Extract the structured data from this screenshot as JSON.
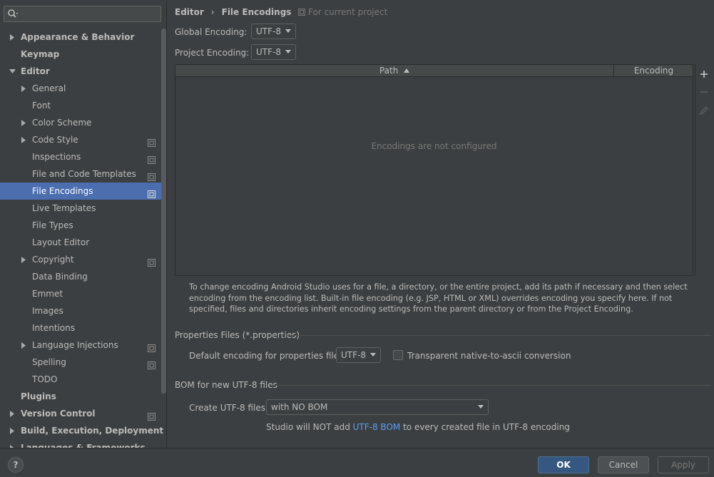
{
  "search": {
    "placeholder": ""
  },
  "sidebar": {
    "items": [
      {
        "label": "Appearance & Behavior",
        "bold": true,
        "level": 0,
        "arrow": "right",
        "proj": false
      },
      {
        "label": "Keymap",
        "bold": true,
        "level": 0,
        "arrow": "none",
        "proj": false
      },
      {
        "label": "Editor",
        "bold": true,
        "level": 0,
        "arrow": "down",
        "proj": false
      },
      {
        "label": "General",
        "bold": false,
        "level": 1,
        "arrow": "right",
        "proj": false
      },
      {
        "label": "Font",
        "bold": false,
        "level": 1,
        "arrow": "none",
        "proj": false
      },
      {
        "label": "Color Scheme",
        "bold": false,
        "level": 1,
        "arrow": "right",
        "proj": false
      },
      {
        "label": "Code Style",
        "bold": false,
        "level": 1,
        "arrow": "right",
        "proj": true
      },
      {
        "label": "Inspections",
        "bold": false,
        "level": 1,
        "arrow": "none",
        "proj": true
      },
      {
        "label": "File and Code Templates",
        "bold": false,
        "level": 1,
        "arrow": "none",
        "proj": true
      },
      {
        "label": "File Encodings",
        "bold": false,
        "level": 1,
        "arrow": "none",
        "proj": true,
        "selected": true
      },
      {
        "label": "Live Templates",
        "bold": false,
        "level": 1,
        "arrow": "none",
        "proj": false
      },
      {
        "label": "File Types",
        "bold": false,
        "level": 1,
        "arrow": "none",
        "proj": false
      },
      {
        "label": "Layout Editor",
        "bold": false,
        "level": 1,
        "arrow": "none",
        "proj": false
      },
      {
        "label": "Copyright",
        "bold": false,
        "level": 1,
        "arrow": "right",
        "proj": true
      },
      {
        "label": "Data Binding",
        "bold": false,
        "level": 1,
        "arrow": "none",
        "proj": false
      },
      {
        "label": "Emmet",
        "bold": false,
        "level": 1,
        "arrow": "none",
        "proj": false
      },
      {
        "label": "Images",
        "bold": false,
        "level": 1,
        "arrow": "none",
        "proj": false
      },
      {
        "label": "Intentions",
        "bold": false,
        "level": 1,
        "arrow": "none",
        "proj": false
      },
      {
        "label": "Language Injections",
        "bold": false,
        "level": 1,
        "arrow": "right",
        "proj": true
      },
      {
        "label": "Spelling",
        "bold": false,
        "level": 1,
        "arrow": "none",
        "proj": true
      },
      {
        "label": "TODO",
        "bold": false,
        "level": 1,
        "arrow": "none",
        "proj": false
      },
      {
        "label": "Plugins",
        "bold": true,
        "level": 0,
        "arrow": "none",
        "proj": false
      },
      {
        "label": "Version Control",
        "bold": true,
        "level": 0,
        "arrow": "right",
        "proj": true
      },
      {
        "label": "Build, Execution, Deployment",
        "bold": true,
        "level": 0,
        "arrow": "right",
        "proj": false
      },
      {
        "label": "Languages & Frameworks",
        "bold": true,
        "level": 0,
        "arrow": "right",
        "proj": false
      }
    ]
  },
  "breadcrumb": {
    "parent": "Editor",
    "sep": "›",
    "current": "File Encodings"
  },
  "scope": {
    "label": "For current project"
  },
  "global_encoding": {
    "label": "Global Encoding:",
    "value": "UTF-8"
  },
  "project_encoding": {
    "label": "Project Encoding:",
    "value": "UTF-8"
  },
  "table": {
    "columns": [
      "Path",
      "Encoding"
    ],
    "empty": "Encodings are not configured"
  },
  "help_text": "To change encoding Android Studio uses for a file, a directory, or the entire project, add its path if necessary and then select encoding from the encoding list. Built-in file encoding (e.g. JSP, HTML or XML) overrides encoding you specify here. If not specified, files and directories inherit encoding settings from the parent directory or from the Project Encoding.",
  "properties": {
    "title": "Properties Files (*.properties)",
    "default_label": "Default encoding for properties files:",
    "default_value": "UTF-8",
    "transparent_label": "Transparent native-to-ascii conversion",
    "transparent_checked": false
  },
  "bom": {
    "title": "BOM for new UTF-8 files",
    "create_label": "Create UTF-8 files:",
    "create_value": "with NO BOM",
    "note_prefix": "Studio will NOT add ",
    "note_link": "UTF-8 BOM",
    "note_suffix": " to every created file in UTF-8 encoding"
  },
  "footer": {
    "help": "?",
    "ok": "OK",
    "cancel": "Cancel",
    "apply": "Apply"
  },
  "colors": {
    "accent": "#4b6eaf",
    "link": "#589df6",
    "primary_button": "#365880"
  }
}
